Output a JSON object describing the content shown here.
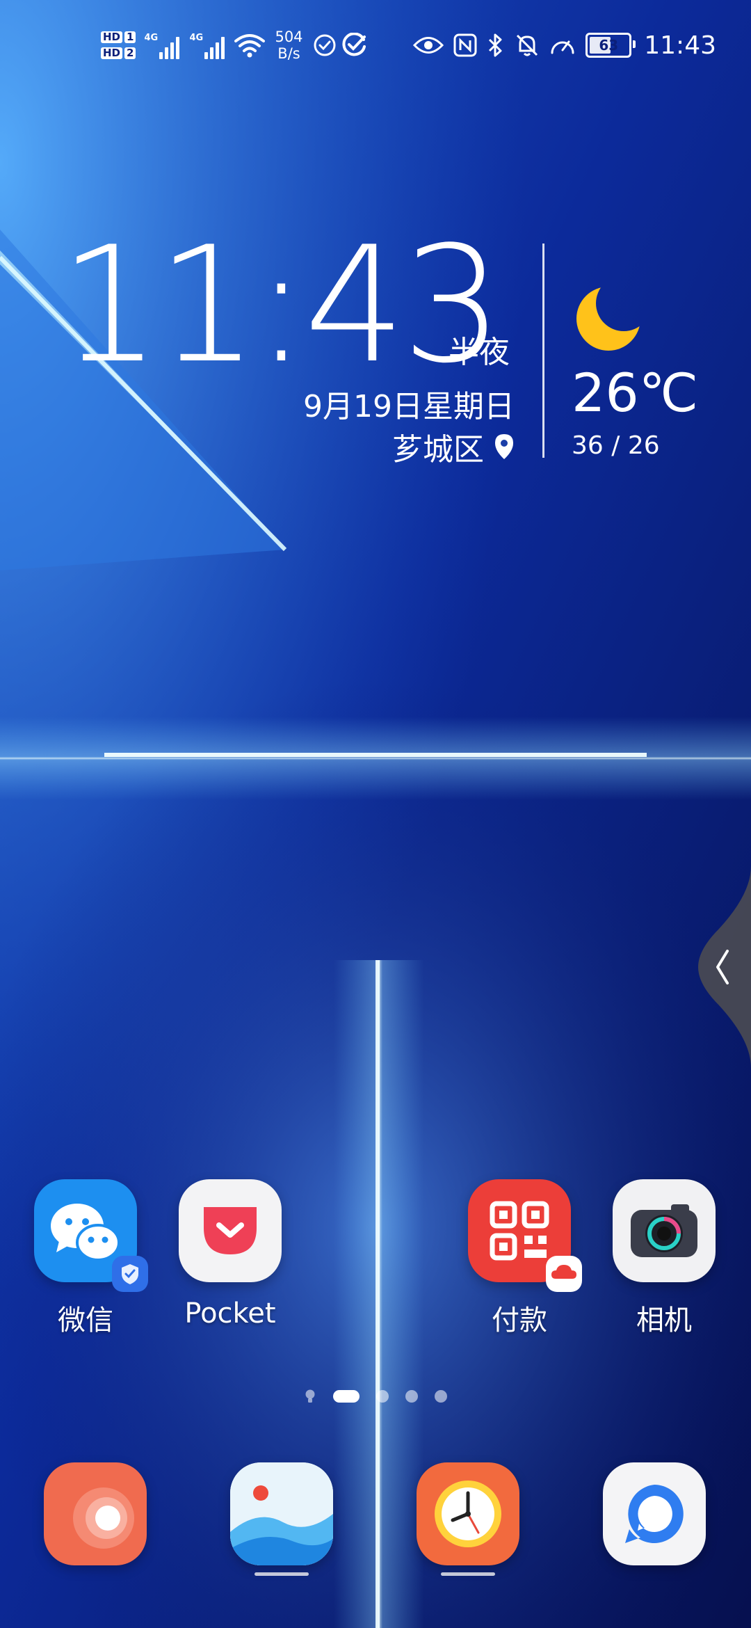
{
  "status_bar": {
    "sim1_label": "HD",
    "sim1_num": "1",
    "sim2_label": "HD",
    "sim2_num": "2",
    "net1": "4G",
    "net2": "4G",
    "speed_value": "504",
    "speed_unit": "B/s",
    "battery_level": "63",
    "time": "11:43",
    "icons_right": [
      "eye-icon",
      "nfc-icon",
      "bluetooth-icon",
      "bell-mute-icon",
      "speedometer-icon"
    ]
  },
  "clock": {
    "time": "11:43",
    "period": "半夜",
    "date": "9月19日星期日",
    "location": "芗城区"
  },
  "weather": {
    "temp": "26℃",
    "range": "36 / 26",
    "icon": "moon-icon"
  },
  "apps": [
    {
      "label": "微信",
      "icon": "wechat-icon",
      "color": "#1d8ff0"
    },
    {
      "label": "Pocket",
      "icon": "pocket-icon",
      "color": "#f3f3f5"
    },
    {
      "label": "付款",
      "icon": "qr-payment-icon",
      "color": "#ec3e39"
    },
    {
      "label": "相机",
      "icon": "camera-icon",
      "color": "#f1f1f3"
    }
  ],
  "page_indicator": {
    "total_pages": 4,
    "active_page": 1
  },
  "dock": [
    {
      "icon": "orange-swirl-app-icon",
      "color": "#f06b4f"
    },
    {
      "icon": "gallery-icon",
      "color": "#e8f4fb"
    },
    {
      "icon": "clock-app-icon",
      "color": "#f26a3e"
    },
    {
      "icon": "chat-bubble-app-icon",
      "color": "#f4f4f6"
    }
  ]
}
